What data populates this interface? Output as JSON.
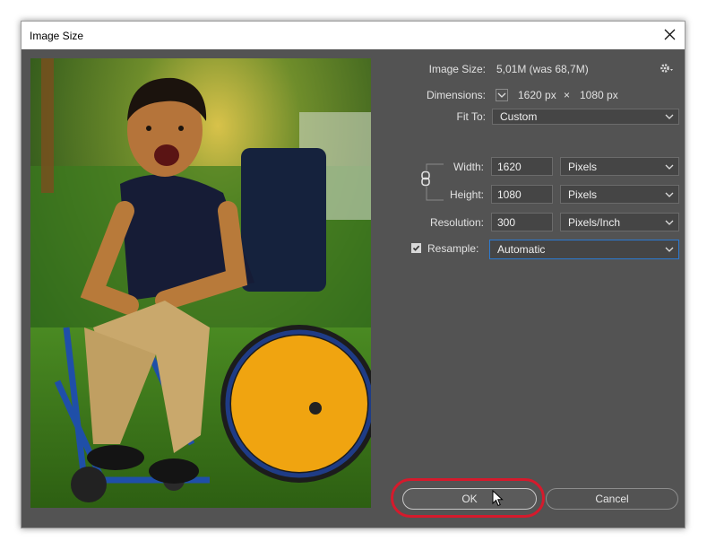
{
  "dialog": {
    "title": "Image Size",
    "image_size_label": "Image Size:",
    "image_size_value": "5,01M (was 68,7M)",
    "dimensions_label": "Dimensions:",
    "dim_width": "1620 px",
    "dim_times": "×",
    "dim_height": "1080 px",
    "fit_to_label": "Fit To:",
    "fit_to_value": "Custom",
    "width_label": "Width:",
    "width_value": "1620",
    "width_unit": "Pixels",
    "height_label": "Height:",
    "height_value": "1080",
    "height_unit": "Pixels",
    "resolution_label": "Resolution:",
    "resolution_value": "300",
    "resolution_unit": "Pixels/Inch",
    "resample_label": "Resample:",
    "resample_checked": true,
    "resample_value": "Automatic",
    "ok_label": "OK",
    "cancel_label": "Cancel"
  },
  "icons": {
    "close": "close-icon",
    "gear": "gear-icon",
    "chevron": "chevron-down-icon",
    "link": "chain-link-icon",
    "checkmark": "checkmark-icon",
    "cursor": "mouse-pointer-icon"
  },
  "colors": {
    "dialog_bg": "#535353",
    "field_bg": "#454545",
    "text": "#e1e1e1",
    "highlight_ring": "#d51a2c",
    "focus_border": "#2c7ad1"
  }
}
